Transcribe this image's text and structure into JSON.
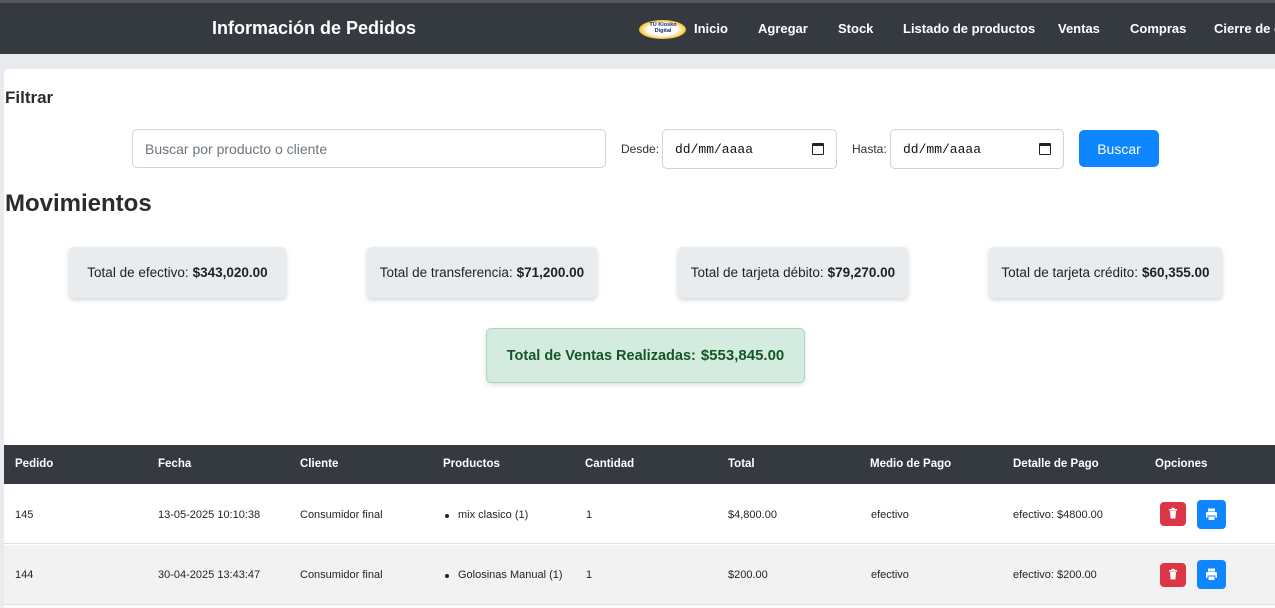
{
  "header": {
    "title": "Información de Pedidos",
    "logo_text": "TÚ Kiosko Digital",
    "nav": [
      "Inicio",
      "Agregar",
      "Stock",
      "Listado de productos",
      "Ventas",
      "Compras",
      "Cierre de c"
    ]
  },
  "filter": {
    "heading": "Filtrar",
    "search_placeholder": "Buscar por producto o cliente",
    "desde_label": "Desde:",
    "desde_value": "dd/mm/aaaa",
    "hasta_label": "Hasta:",
    "hasta_value": "dd/mm/aaaa",
    "button": "Buscar"
  },
  "movimientos": {
    "heading": "Movimientos",
    "stats": [
      {
        "label": "Total de efectivo:",
        "value": "$343,020.00"
      },
      {
        "label": "Total de transferencia:",
        "value": "$71,200.00"
      },
      {
        "label": "Total de tarjeta débito:",
        "value": "$79,270.00"
      },
      {
        "label": "Total de tarjeta crédito:",
        "value": "$60,355.00"
      }
    ],
    "total_label": "Total de Ventas Realizadas:",
    "total_value": "$553,845.00"
  },
  "table": {
    "columns": [
      "Pedido",
      "Fecha",
      "Cliente",
      "Productos",
      "Cantidad",
      "Total",
      "Medio de Pago",
      "Detalle de Pago",
      "Opciones"
    ],
    "rows": [
      {
        "pedido": "145",
        "fecha": "13-05-2025 10:10:38",
        "cliente": "Consumidor final",
        "producto": "mix clasico (1)",
        "cantidad": "1",
        "total": "$4,800.00",
        "medio": "efectivo",
        "detalle": "efectivo: $4800.00"
      },
      {
        "pedido": "144",
        "fecha": "30-04-2025 13:43:47",
        "cliente": "Consumidor final",
        "producto": "Golosinas Manual (1)",
        "cantidad": "1",
        "total": "$200.00",
        "medio": "efectivo",
        "detalle": "efectivo: $200.00"
      }
    ]
  },
  "icons": {
    "delete": "trash-icon",
    "print": "printer-icon"
  },
  "colors": {
    "navbar": "#343a40",
    "primary": "#0d86ff",
    "danger": "#dc3545",
    "success_bg": "#d4ecdf",
    "success_text": "#155724"
  }
}
